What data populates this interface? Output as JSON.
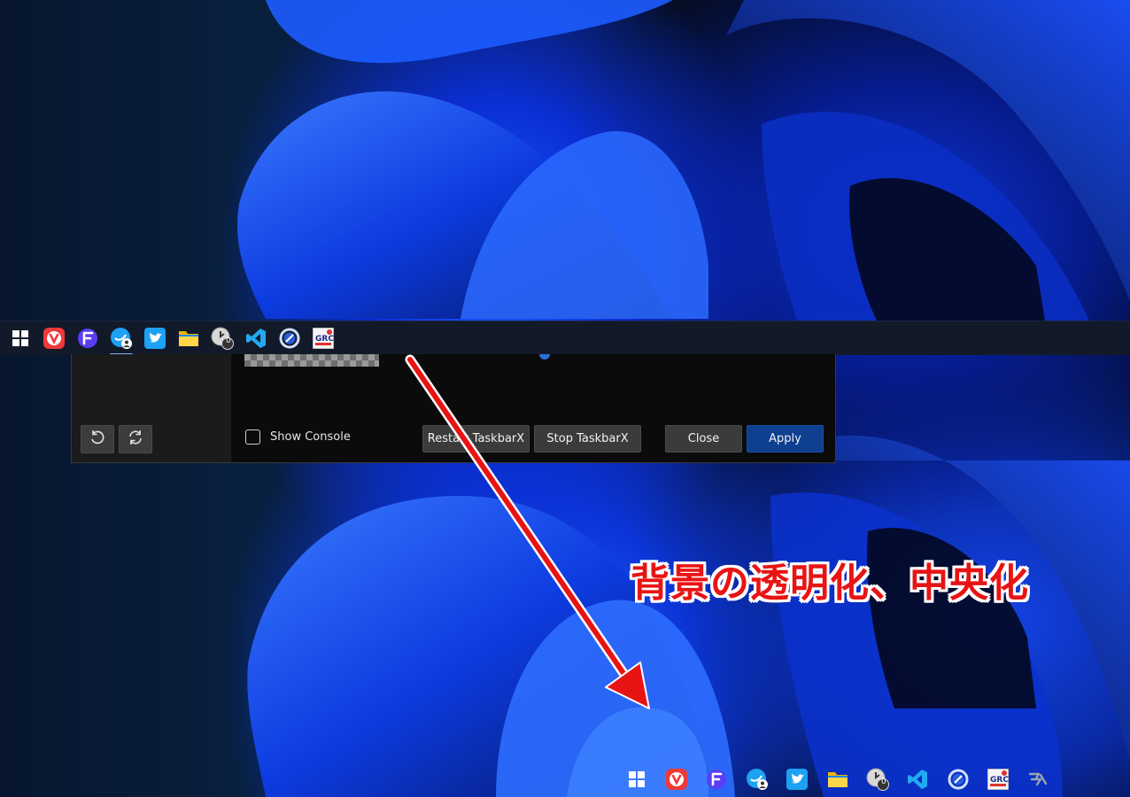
{
  "colors": {
    "taskbar_bg": "#121a2a",
    "window_bg": "#0b0b0b",
    "sidebar_bg": "#1b1b1b",
    "button_gray": "#3b3b3b",
    "button_accent": "#0f3f8f",
    "annotation_red": "#e81414"
  },
  "taskbar_top": {
    "icons": [
      {
        "name": "start-icon"
      },
      {
        "name": "vivaldi-icon"
      },
      {
        "name": "fences-icon"
      },
      {
        "name": "twitter-client-profile-icon",
        "active": true
      },
      {
        "name": "twitter-icon"
      },
      {
        "name": "file-explorer-icon"
      },
      {
        "name": "clock-badge-icon",
        "badge": "0"
      },
      {
        "name": "vscode-icon"
      },
      {
        "name": "simplenote-icon"
      },
      {
        "name": "grc-icon"
      }
    ]
  },
  "config_window": {
    "show_console_label": "Show Console",
    "show_console_checked": false,
    "buttons": {
      "restart": "Restart TaskbarX",
      "stop": "Stop TaskbarX",
      "close": "Close",
      "apply": "Apply"
    }
  },
  "annotation": {
    "text": "背景の透明化、中央化"
  },
  "taskbar_bottom": {
    "icons": [
      {
        "name": "start-icon"
      },
      {
        "name": "vivaldi-icon"
      },
      {
        "name": "fences-icon"
      },
      {
        "name": "twitter-client-profile-icon"
      },
      {
        "name": "twitter-icon"
      },
      {
        "name": "file-explorer-icon"
      },
      {
        "name": "clock-badge-icon",
        "badge": "0"
      },
      {
        "name": "vscode-icon"
      },
      {
        "name": "simplenote-icon"
      },
      {
        "name": "grc-icon"
      },
      {
        "name": "taskbarx-icon"
      }
    ]
  }
}
